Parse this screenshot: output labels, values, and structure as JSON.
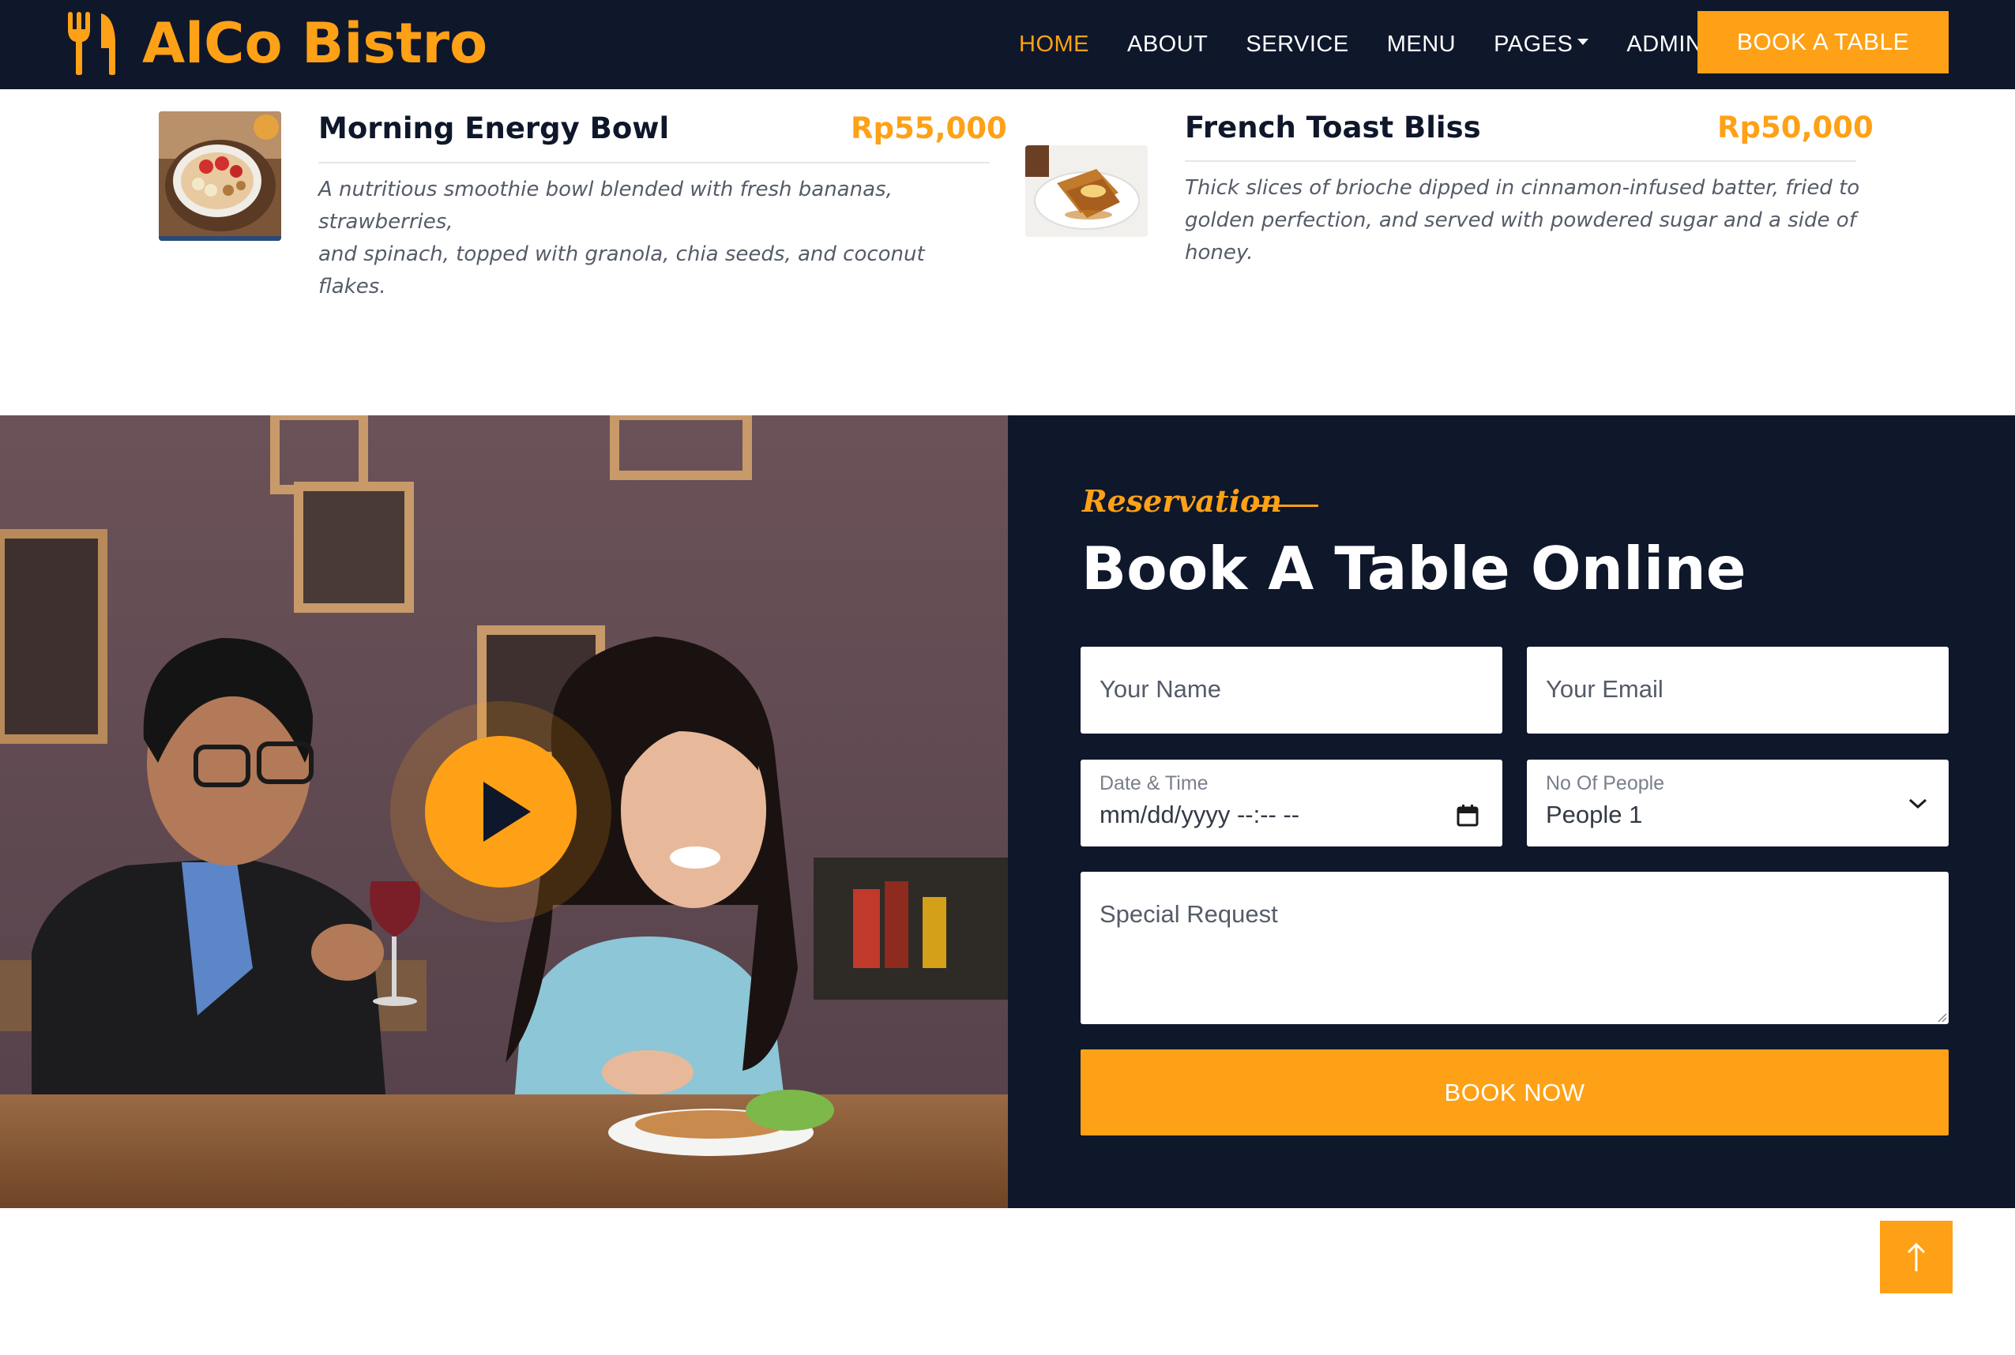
{
  "brand": {
    "name": "AlCo Bistro",
    "icon": "fork-knife-icon"
  },
  "nav": {
    "items": [
      {
        "label": "HOME",
        "active": true
      },
      {
        "label": "ABOUT"
      },
      {
        "label": "SERVICE"
      },
      {
        "label": "MENU"
      },
      {
        "label": "PAGES",
        "has_dropdown": true
      },
      {
        "label": "ADMIN"
      }
    ],
    "cta_label": "BOOK A TABLE"
  },
  "menu_items": [
    {
      "name": "Morning Energy Bowl",
      "price": "Rp55,000",
      "description_lines": [
        "A nutritious smoothie bowl blended with fresh bananas, strawberries,",
        "and spinach, topped with granola, chia seeds, and coconut flakes."
      ]
    },
    {
      "name": "French Toast Bliss",
      "price": "Rp50,000",
      "description_lines": [
        "Thick slices of brioche dipped in cinnamon-infused batter, fried to",
        "golden perfection, and served with powdered sugar and a side of",
        "honey."
      ]
    }
  ],
  "reservation": {
    "tag": "Reservation",
    "title": "Book A Table Online",
    "name_placeholder": "Your Name",
    "email_placeholder": "Your Email",
    "datetime_label": "Date & Time",
    "datetime_value": "mm/dd/yyyy --:-- --",
    "people_label": "No Of People",
    "people_value": "People 1",
    "request_placeholder": "Special Request",
    "submit_label": "BOOK NOW"
  },
  "colors": {
    "navy": "#0F172B",
    "accent": "#FEA116",
    "white": "#FFFFFF"
  },
  "icons": [
    "play-icon",
    "calendar-icon",
    "chevron-down-icon",
    "arrow-up-icon"
  ]
}
